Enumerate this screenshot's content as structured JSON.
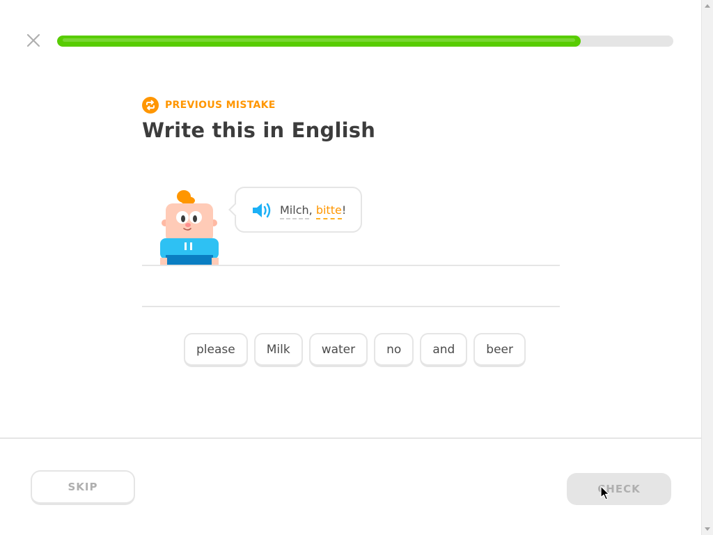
{
  "header": {
    "close_icon": "close-icon",
    "progress": 0.85,
    "progress_color": "#58cc02"
  },
  "challenge": {
    "badge_label": "PREVIOUS MISTAKE",
    "badge_icon": "repeat-icon",
    "badge_color": "#ff9600",
    "title": "Write this in English",
    "prompt": {
      "speaker_icon": "speaker-icon",
      "word1": "Milch",
      "separator": ",",
      "word2": "bitte",
      "end_punct": "!"
    }
  },
  "word_bank": [
    "please",
    "Milk",
    "water",
    "no",
    "and",
    "beer"
  ],
  "footer": {
    "skip_label": "SKIP",
    "check_label": "CHECK"
  }
}
